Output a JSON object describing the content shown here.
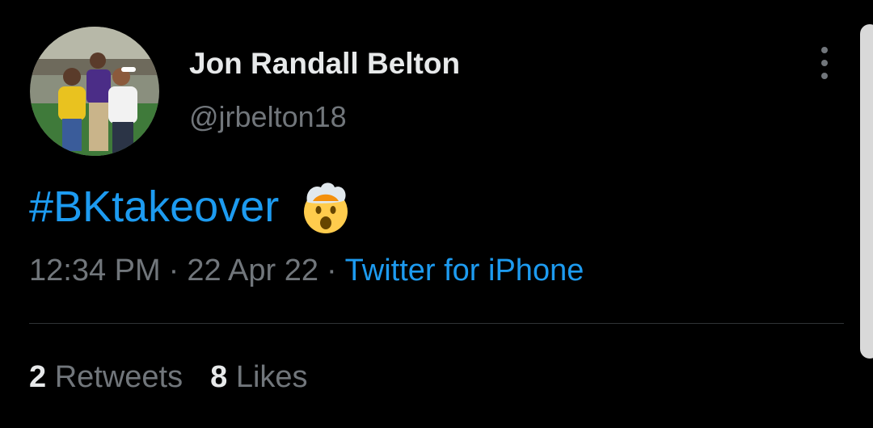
{
  "tweet": {
    "author": {
      "display_name": "Jon Randall Belton",
      "handle": "@jrbelton18",
      "avatar_icon": "profile-photo"
    },
    "text": {
      "hashtag": "#BKtakeover",
      "emoji_icon": "exploding-head-emoji"
    },
    "meta": {
      "time": "12:34 PM",
      "separator": "·",
      "date": "22 Apr 22",
      "source": "Twitter for iPhone"
    },
    "stats": {
      "retweets_count": "2",
      "retweets_label": "Retweets",
      "likes_count": "8",
      "likes_label": "Likes"
    }
  },
  "colors": {
    "background": "#000000",
    "primary_text": "#e7e9ea",
    "secondary_text": "#71767b",
    "link": "#1d9bf0",
    "divider": "#2f3336"
  }
}
